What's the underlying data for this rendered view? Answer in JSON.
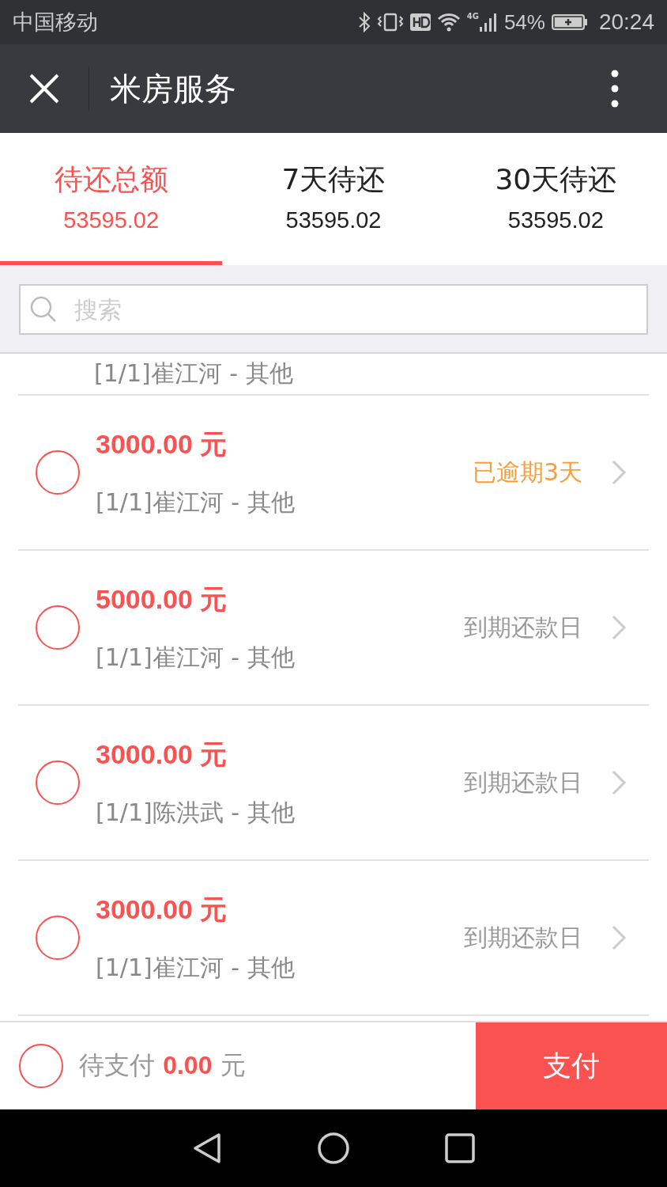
{
  "status_bar": {
    "carrier": "中国移动",
    "network": "4G",
    "battery": "54%",
    "time": "20:24"
  },
  "header": {
    "title": "米房服务"
  },
  "tabs": [
    {
      "label": "待还总额",
      "amount": "53595.02",
      "selected": true
    },
    {
      "label": "7天待还",
      "amount": "53595.02",
      "selected": false
    },
    {
      "label": "30天待还",
      "amount": "53595.02",
      "selected": false
    }
  ],
  "search": {
    "placeholder": "搜索"
  },
  "partial_row": {
    "subtitle": "[1/1]崔江河 - 其他"
  },
  "rows": [
    {
      "amount": "3000.00 元",
      "subtitle": "[1/1]崔江河 - 其他",
      "status": "已逾期3天",
      "kind": "overdue",
      "checked": false
    },
    {
      "amount": "5000.00 元",
      "subtitle": "[1/1]崔江河 - 其他",
      "status": "到期还款日",
      "kind": "due",
      "checked": false
    },
    {
      "amount": "3000.00 元",
      "subtitle": "[1/1]陈洪武 - 其他",
      "status": "到期还款日",
      "kind": "due",
      "checked": false
    },
    {
      "amount": "3000.00 元",
      "subtitle": "[1/1]崔江河 - 其他",
      "status": "到期还款日",
      "kind": "due",
      "checked": false
    }
  ],
  "footer": {
    "label": "待支付 **0.00** 元",
    "checked": false,
    "pay_button": "支付"
  }
}
